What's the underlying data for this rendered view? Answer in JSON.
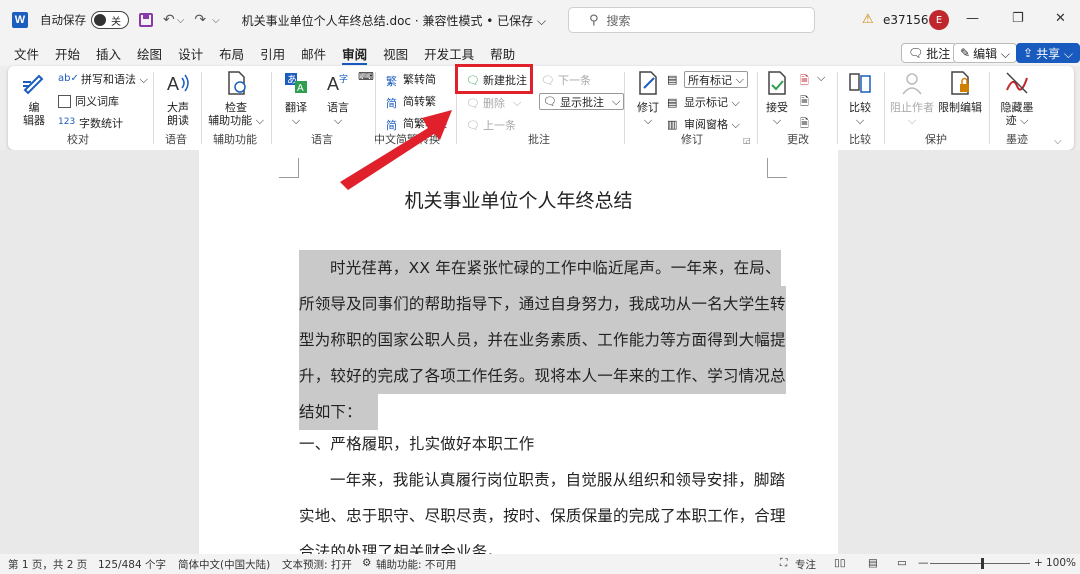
{
  "titlebar": {
    "app_logo": "W",
    "autosave_label": "自动保存",
    "autosave_state": "关",
    "doc_title": "机关事业单位个人年终总结.doc · 兼容性模式 • 已保存 ⌵",
    "search_placeholder": "搜索",
    "username": "e37156",
    "avatar_initial": "E"
  },
  "tabs": [
    "文件",
    "开始",
    "插入",
    "绘图",
    "设计",
    "布局",
    "引用",
    "邮件",
    "审阅",
    "视图",
    "开发工具",
    "帮助"
  ],
  "active_tab": "审阅",
  "right_buttons": {
    "comment": "批注",
    "edit": "编辑 ⌵",
    "share": "共享 ⌵"
  },
  "ribbon": {
    "proofing": {
      "editor": "编\n辑器",
      "spelling": "拼写和语法 ⌵",
      "thesaurus": "同义词库",
      "wordcount": "字数统计",
      "label": "校对"
    },
    "speech": {
      "readaloud_1": "大声",
      "readaloud_2": "朗读",
      "label": "语音"
    },
    "accessibility": {
      "check_1": "检查",
      "check_2": "辅助功能 ⌵",
      "label": "辅助功能"
    },
    "language": {
      "translate": "翻译",
      "language": "语言",
      "label": "语言"
    },
    "chinese": {
      "to_simplified": "繁转简",
      "to_traditional": "简转繁",
      "convert": "简繁转换",
      "label": "中文简繁转换"
    },
    "comments": {
      "new_comment": "新建批注",
      "delete": "删除",
      "prev": "上一条",
      "next": "下一条",
      "show_comments": "显示批注",
      "label": "批注"
    },
    "tracking": {
      "track": "修订",
      "markup_select": "所有标记",
      "show_markup": "显示标记 ⌵",
      "review_pane": "审阅窗格 ⌵",
      "label": "修订"
    },
    "changes": {
      "accept": "接受",
      "label": "更改"
    },
    "compare": {
      "compare": "比较",
      "label": "比较"
    },
    "protect": {
      "block_authors": "阻止作者",
      "restrict": "限制编辑",
      "label": "保护"
    },
    "ink": {
      "hide_ink_1": "隐藏墨",
      "hide_ink_2": "迹 ⌵",
      "label": "墨迹"
    }
  },
  "document": {
    "title": "机关事业单位个人年终总结",
    "lines": [
      "时光荏苒，XX 年在紧张忙碌的工作中临近尾声。一年来，在局、",
      "所领导及同事们的帮助指导下，通过自身努力，我成功从一名大学生转",
      "型为称职的国家公职人员，并在业务素质、工作能力等方面得到大幅提",
      "升，较好的完成了各项工作任务。现将本人一年来的工作、学习情况总",
      "结如下：",
      "一、严格履职，扎实做好本职工作",
      "一年来，我能认真履行岗位职责，自觉服从组织和领导安排，脚踏",
      "实地、忠于职守、尽职尽责，按时、保质保量的完成了本职工作，合理",
      "合法的处理了相关财会业务。"
    ]
  },
  "statusbar": {
    "page": "第 1 页，共 2 页",
    "words": "125/484 个字",
    "language": "简体中文(中国大陆)",
    "prediction": "文本预测: 打开",
    "accessibility": "辅助功能: 不可用",
    "focus": "专注",
    "zoom": "100%"
  },
  "colors": {
    "accent": "#185abd",
    "highlight_box": "#e0202a",
    "arrow": "#e0202a",
    "selection": "#c9c9c9"
  }
}
